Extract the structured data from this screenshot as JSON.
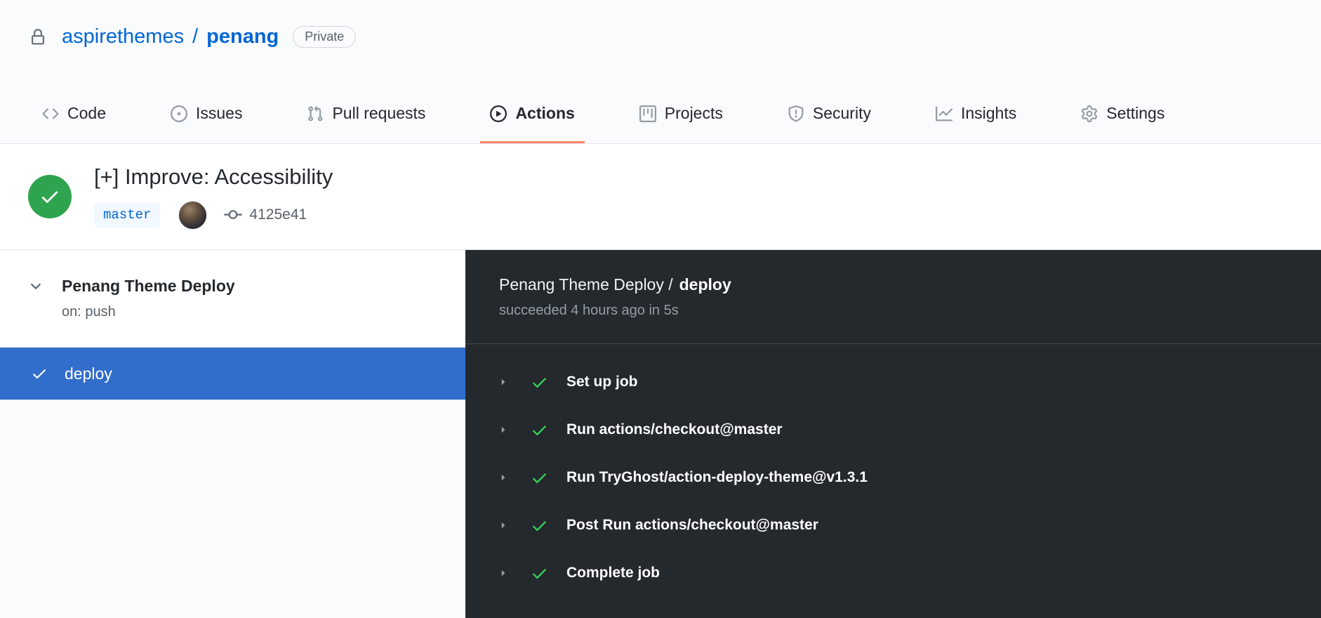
{
  "header": {
    "breadcrumb": {
      "owner": "aspirethemes",
      "separator": "/",
      "repo": "penang"
    },
    "visibility_badge": "Private",
    "tabs": [
      {
        "label": "Code",
        "icon": "code-icon",
        "active": false
      },
      {
        "label": "Issues",
        "icon": "issue-opened-icon",
        "active": false
      },
      {
        "label": "Pull requests",
        "icon": "git-pull-request-icon",
        "active": false
      },
      {
        "label": "Actions",
        "icon": "play-circle-icon",
        "active": true
      },
      {
        "label": "Projects",
        "icon": "project-icon",
        "active": false
      },
      {
        "label": "Security",
        "icon": "shield-icon",
        "active": false
      },
      {
        "label": "Insights",
        "icon": "graph-icon",
        "active": false
      },
      {
        "label": "Settings",
        "icon": "gear-icon",
        "active": false
      }
    ]
  },
  "run_header": {
    "status": "success",
    "title": "[+] Improve: Accessibility",
    "branch": "master",
    "commit": "4125e41"
  },
  "sidebar": {
    "workflow_name": "Penang Theme Deploy",
    "trigger": "on: push",
    "jobs": [
      {
        "name": "deploy",
        "status": "success",
        "selected": true
      }
    ]
  },
  "job_panel": {
    "title_prefix": "Penang Theme Deploy /",
    "job_name": "deploy",
    "summary": "succeeded 4 hours ago in 5s",
    "steps": [
      {
        "name": "Set up job",
        "status": "success"
      },
      {
        "name": "Run actions/checkout@master",
        "status": "success"
      },
      {
        "name": "Run TryGhost/action-deploy-theme@v1.3.1",
        "status": "success"
      },
      {
        "name": "Post Run actions/checkout@master",
        "status": "success"
      },
      {
        "name": "Complete job",
        "status": "success"
      }
    ]
  },
  "colors": {
    "tab_accent": "#f9826c",
    "link_blue": "#0366d6",
    "success_green": "#2ea44f",
    "step_check_green": "#34d058",
    "selected_job_bg": "#316dca",
    "dark_panel_bg": "#24292e",
    "header_bg": "#fafbfc"
  }
}
